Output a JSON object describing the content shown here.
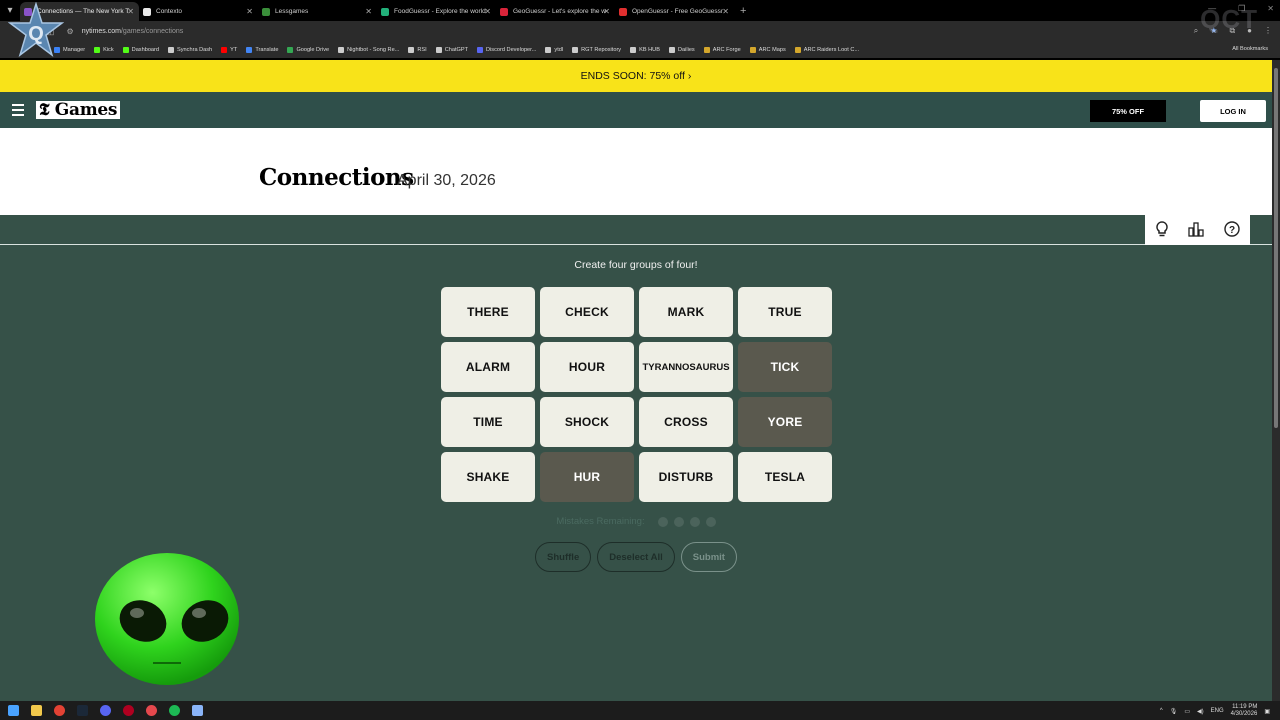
{
  "browser": {
    "tabs": [
      {
        "title": "Connections — The New York T",
        "active": true,
        "color": "#8a53c9"
      },
      {
        "title": "Contexto",
        "active": false,
        "color": "#e8e8e8"
      },
      {
        "title": "Lessgames",
        "active": false,
        "color": "#3a8f3a"
      },
      {
        "title": "FoodGuessr - Explore the world",
        "active": false,
        "color": "#22b07a"
      },
      {
        "title": "GeoGuessr - Let's explore the w",
        "active": false,
        "color": "#d9243a"
      },
      {
        "title": "OpenGuessr - Free GeoGuessr",
        "active": false,
        "color": "#e02f2f"
      }
    ],
    "url_host": "nytimes.com",
    "url_path": "/games/connections",
    "bookmarks": [
      {
        "label": "Manager",
        "color": "#3b82f6"
      },
      {
        "label": "Kick",
        "color": "#53fc18"
      },
      {
        "label": "Dashboard",
        "color": "#53fc18"
      },
      {
        "label": "Synchra Dash",
        "color": "#cccccc"
      },
      {
        "label": "YT",
        "color": "#ff0000"
      },
      {
        "label": "Translate",
        "color": "#4285f4"
      },
      {
        "label": "Google Drive",
        "color": "#34a853"
      },
      {
        "label": "Nightbot - Song Re...",
        "color": "#cccccc"
      },
      {
        "label": "RSI",
        "color": "#cccccc"
      },
      {
        "label": "ChatGPT",
        "color": "#cccccc"
      },
      {
        "label": "Discord Developer...",
        "color": "#5865f2"
      },
      {
        "label": "ytdl",
        "color": "#cccccc"
      },
      {
        "label": "RGT Repository",
        "color": "#cccccc"
      },
      {
        "label": "KB HUB",
        "color": "#cccccc"
      },
      {
        "label": "Dailies",
        "color": "#cccccc"
      },
      {
        "label": "ARC Forge",
        "color": "#d4a72c"
      },
      {
        "label": "ARC Maps",
        "color": "#d4a72c"
      },
      {
        "label": "ARC Raiders Loot C...",
        "color": "#d4a72c"
      }
    ],
    "all_bookmarks": "All Bookmarks"
  },
  "promo": {
    "text": "ENDS SOON:",
    "offer": "75% off",
    "arrow": "›"
  },
  "nav": {
    "logo": "Games",
    "offer_button": "75% OFF",
    "login_button": "LOG IN"
  },
  "game": {
    "title": "Connections",
    "date": "April 30, 2026",
    "instructions": "Create four groups of four!",
    "tiles": [
      {
        "word": "THERE",
        "selected": false
      },
      {
        "word": "CHECK",
        "selected": false
      },
      {
        "word": "MARK",
        "selected": false
      },
      {
        "word": "TRUE",
        "selected": false
      },
      {
        "word": "ALARM",
        "selected": false
      },
      {
        "word": "HOUR",
        "selected": false
      },
      {
        "word": "TYRANNOSAURUS",
        "selected": false
      },
      {
        "word": "TICK",
        "selected": true
      },
      {
        "word": "TIME",
        "selected": false
      },
      {
        "word": "SHOCK",
        "selected": false
      },
      {
        "word": "CROSS",
        "selected": false
      },
      {
        "word": "YORE",
        "selected": true
      },
      {
        "word": "SHAKE",
        "selected": false
      },
      {
        "word": "HUR",
        "selected": true
      },
      {
        "word": "DISTURB",
        "selected": false
      },
      {
        "word": "TESLA",
        "selected": false
      }
    ],
    "mistakes_label": "Mistakes Remaining:",
    "mistakes_remaining": 4,
    "buttons": {
      "shuffle": "Shuffle",
      "deselect": "Deselect All",
      "submit": "Submit"
    },
    "colors": {
      "background": "#365148",
      "tile": "#efefe6",
      "selected_tile": "#5a594e"
    }
  },
  "taskbar": {
    "lang": "ENG",
    "time": "11:19 PM",
    "date": "4/30/2026"
  },
  "overlay": {
    "watermark": "QCT"
  }
}
